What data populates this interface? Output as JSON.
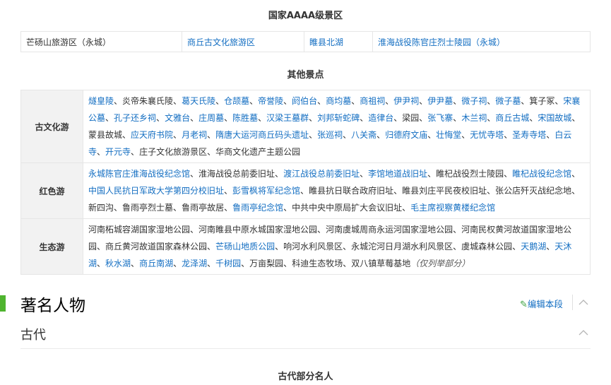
{
  "titles": {
    "aaaa": "国家AAAA级景区",
    "others": "其他景点",
    "ancient_people": "古代部分名人"
  },
  "aaaa_items": [
    {
      "text": "芒砀山旅游区（永城）",
      "link": false
    },
    {
      "text": "商丘古文化旅游区",
      "link": true
    },
    {
      "text": "睢县北湖",
      "link": true
    },
    {
      "text": "淮海战役陈官庄烈士陵园（永城）",
      "link": true
    }
  ],
  "categories": [
    {
      "name": "古文化游",
      "items": [
        {
          "t": "燧皇陵",
          "l": true
        },
        {
          "t": "炎帝朱襄氏陵",
          "l": false
        },
        {
          "t": "葛天氏陵",
          "l": true
        },
        {
          "t": "仓颉墓",
          "l": true
        },
        {
          "t": "帝誉陵",
          "l": true
        },
        {
          "t": "阏伯台",
          "l": true
        },
        {
          "t": "商均墓",
          "l": true
        },
        {
          "t": "商祖祠",
          "l": true
        },
        {
          "t": "伊尹祠",
          "l": true
        },
        {
          "t": "伊尹墓",
          "l": true
        },
        {
          "t": "微子祠",
          "l": true
        },
        {
          "t": "微子墓",
          "l": true
        },
        {
          "t": "箕子冢",
          "l": false
        },
        {
          "t": "宋襄公墓",
          "l": true
        },
        {
          "t": "孔子还乡祠",
          "l": true
        },
        {
          "t": "文雅台",
          "l": true
        },
        {
          "t": "庄周墓",
          "l": true
        },
        {
          "t": "陈胜墓",
          "l": true
        },
        {
          "t": "汉梁王墓群",
          "l": true
        },
        {
          "t": "刘邦斩蛇碑",
          "l": true
        },
        {
          "t": "造律台",
          "l": true
        },
        {
          "t": "梁园",
          "l": false
        },
        {
          "t": "张飞寨",
          "l": true
        },
        {
          "t": "木兰祠",
          "l": true
        },
        {
          "t": "商丘古城",
          "l": true
        },
        {
          "t": "宋国故城",
          "l": true
        },
        {
          "t": "蒙县故城",
          "l": false
        },
        {
          "t": "应天府书院",
          "l": true
        },
        {
          "t": "月老祠",
          "l": true
        },
        {
          "t": "隋唐大运河商丘码头遗址",
          "l": true
        },
        {
          "t": "张巡祠",
          "l": true
        },
        {
          "t": "八关斋",
          "l": true
        },
        {
          "t": "归德府文庙",
          "l": true
        },
        {
          "t": "壮悔堂",
          "l": true
        },
        {
          "t": "无忧寺塔",
          "l": true
        },
        {
          "t": "圣寿寺塔",
          "l": true
        },
        {
          "t": "白云寺",
          "l": true
        },
        {
          "t": "开元寺",
          "l": true
        },
        {
          "t": "庄子文化旅游景区",
          "l": false
        },
        {
          "t": "华商文化遗产主题公园",
          "l": false
        }
      ]
    },
    {
      "name": "红色游",
      "items": [
        {
          "t": "永城陈官庄淮海战役纪念馆",
          "l": true
        },
        {
          "t": "淮海战役总前委旧址",
          "l": false
        },
        {
          "t": "渡江战役总前委旧址",
          "l": true
        },
        {
          "t": "李馆地道战旧址",
          "l": true
        },
        {
          "t": "睢杞战役烈士陵园",
          "l": false
        },
        {
          "t": "睢杞战役纪念馆",
          "l": true
        },
        {
          "t": "中国人民抗日军政大学第四分校旧址",
          "l": true
        },
        {
          "t": "彭雪枫将军纪念馆",
          "l": true
        },
        {
          "t": "睢县抗日联合政府旧址",
          "l": false
        },
        {
          "t": "睢县刘庄平民夜校旧址",
          "l": false
        },
        {
          "t": "张公店歼灭战纪念地",
          "l": false
        },
        {
          "t": "新四沟",
          "l": false
        },
        {
          "t": "鲁雨亭烈士墓",
          "l": false
        },
        {
          "t": "鲁雨亭故居",
          "l": false
        },
        {
          "t": "鲁雨亭纪念馆",
          "l": true
        },
        {
          "t": "中共中央中原局扩大会议旧址",
          "l": false
        },
        {
          "t": "毛主席视察黄楼纪念馆",
          "l": true
        }
      ]
    },
    {
      "name": "生态游",
      "items": [
        {
          "t": "河南柘城容湖国家湿地公园",
          "l": false
        },
        {
          "t": "河南睢县中原水城国家湿地公园",
          "l": false
        },
        {
          "t": "河南虞城周商永运河国家湿地公园",
          "l": false
        },
        {
          "t": "河南民权黄河故道国家湿地公园",
          "l": false
        },
        {
          "t": "商丘黄河故道国家森林公园",
          "l": false
        },
        {
          "t": "芒砀山地质公园",
          "l": true
        },
        {
          "t": "响河水利风景区",
          "l": false
        },
        {
          "t": "永城沱河日月湖水利风景区",
          "l": false
        },
        {
          "t": "虞城森林公园",
          "l": false
        },
        {
          "t": "天鹅湖",
          "l": true
        },
        {
          "t": "天沐湖",
          "l": true
        },
        {
          "t": "秋水湖",
          "l": true
        },
        {
          "t": "商丘南湖",
          "l": true
        },
        {
          "t": "龙泽湖",
          "l": true
        },
        {
          "t": "千树园",
          "l": true
        },
        {
          "t": "万亩梨园",
          "l": false
        },
        {
          "t": "科迪生态牧场",
          "l": false
        },
        {
          "t": "双八镇草莓基地",
          "l": false
        }
      ],
      "note": "（仅列举部分）"
    }
  ],
  "section": {
    "heading": "著名人物",
    "edit_label": "编辑本段",
    "subheading": "古代"
  },
  "icons": {
    "edit": "pencil-icon",
    "collapse": "chevron-up-icon"
  },
  "colors": {
    "link": "#136ec2",
    "accent": "#4fb42f",
    "cat_bg": "#f2f2f2",
    "border": "#e6e6e6"
  }
}
